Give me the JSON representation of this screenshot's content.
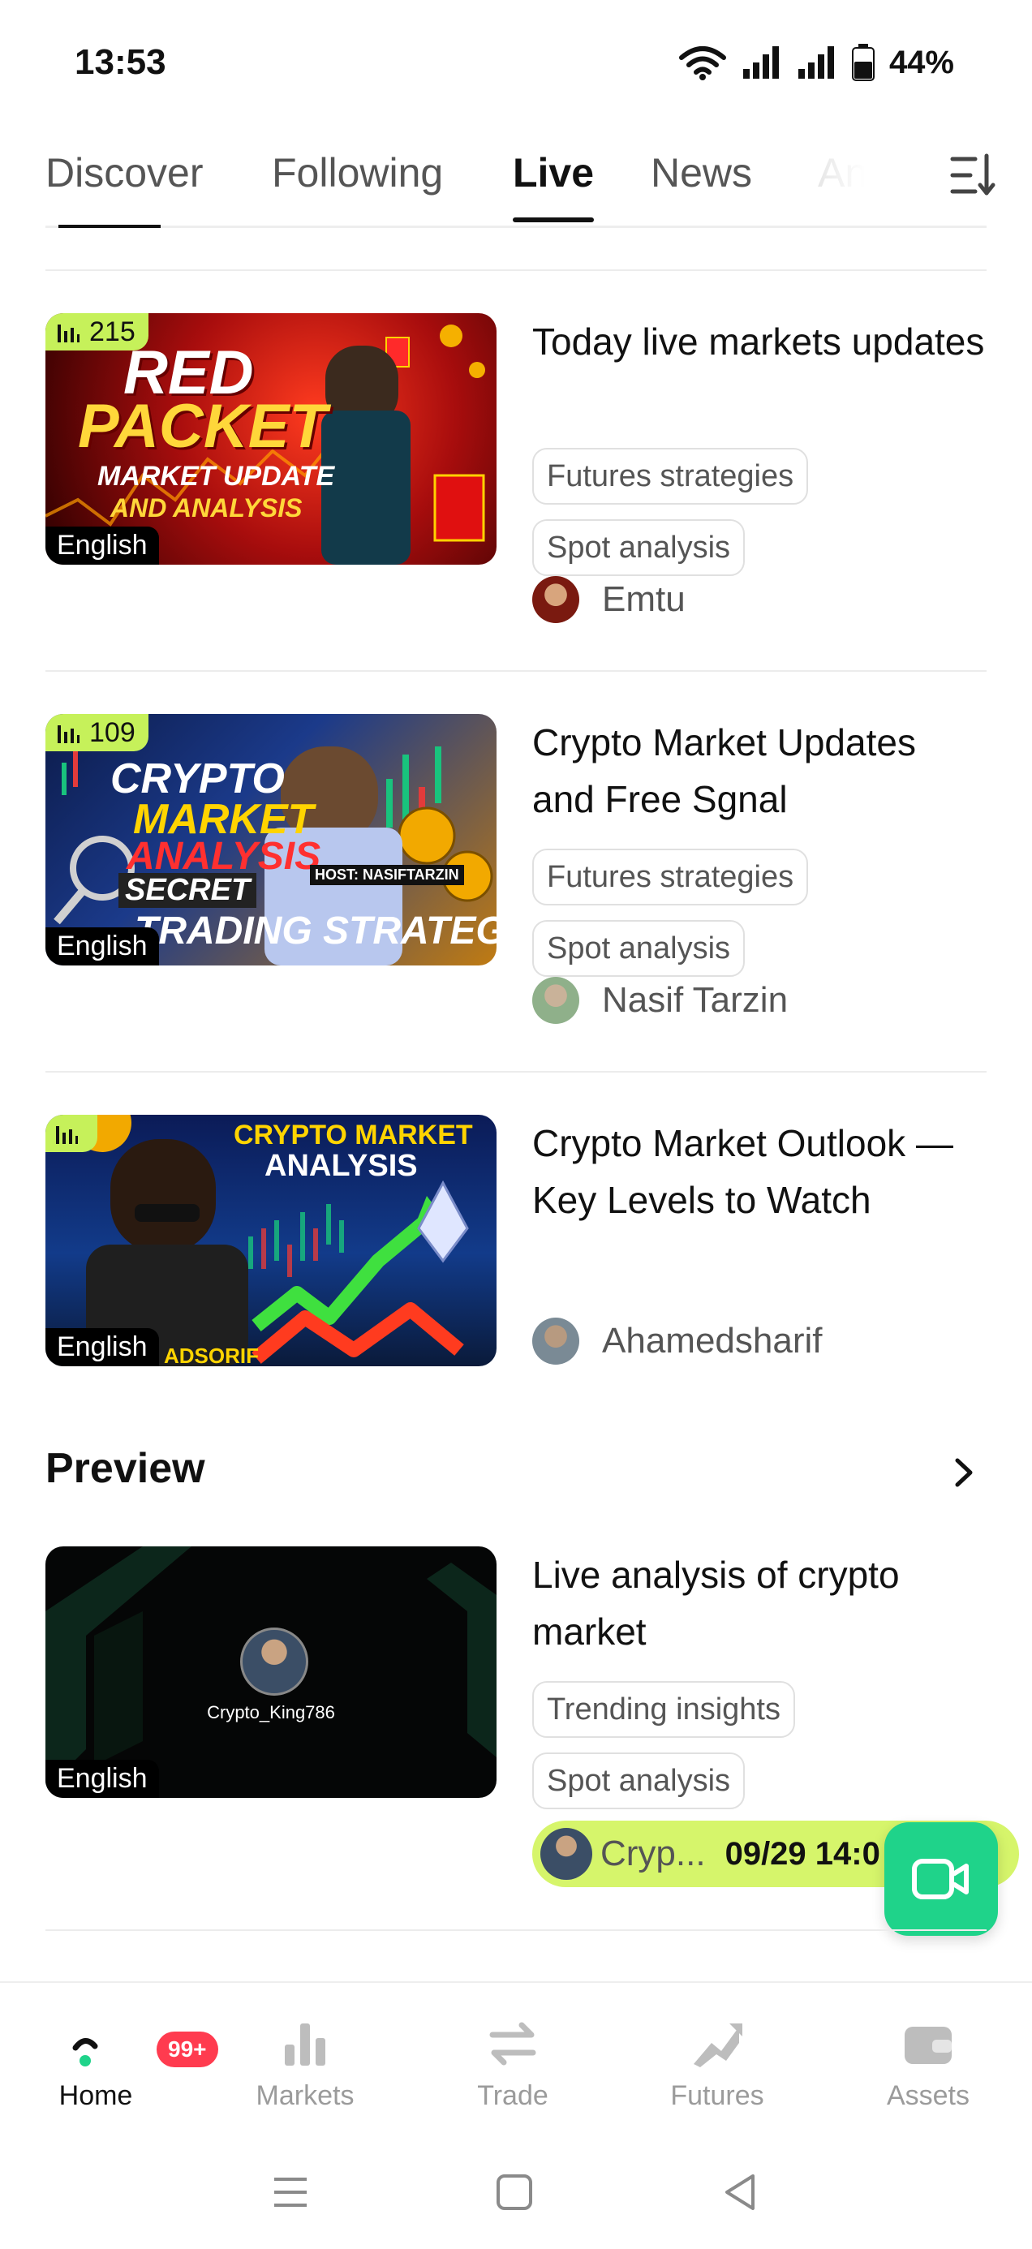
{
  "status": {
    "time": "13:53",
    "battery": "44%"
  },
  "tabs": [
    {
      "label": "Discover"
    },
    {
      "label": "Following"
    },
    {
      "label": "Live"
    },
    {
      "label": "News"
    },
    {
      "label": "An"
    }
  ],
  "live": [
    {
      "viewers": "215",
      "language": "English",
      "thumb_text": [
        "RED",
        "PACKET",
        "MARKET UPDATE",
        "AND ANALYSIS"
      ],
      "title": "Today live markets updates",
      "tags": [
        "Futures strategies",
        "Spot analysis"
      ],
      "author": "Emtu"
    },
    {
      "viewers": "109",
      "language": "English",
      "thumb_text": [
        "CRYPTO",
        "MARKET",
        "ANALYSIS",
        "SECRET",
        "TRADING STRATEGY",
        "HOST: NASIFTARZIN"
      ],
      "title": "Crypto Market Updates and Free Sgnal",
      "tags": [
        "Futures strategies",
        "Spot analysis"
      ],
      "author": "Nasif Tarzin"
    },
    {
      "viewers": "",
      "language": "English",
      "thumb_text": [
        "CRYPTO MARKET",
        "ANALYSIS",
        "ADSORIF"
      ],
      "title": "Crypto Market Outlook — Key Levels to Watch",
      "tags": [],
      "author": "Ahamedsharif"
    }
  ],
  "preview": {
    "section_title": "Preview",
    "item": {
      "language": "English",
      "channel": "Crypto_King786",
      "title": "Live analysis of crypto market",
      "tags": [
        "Trending insights",
        "Spot analysis"
      ],
      "host_short": "Cryp...",
      "schedule": "09/29 14:0"
    }
  },
  "nav": [
    {
      "label": "Home",
      "badge": "99+"
    },
    {
      "label": "Markets"
    },
    {
      "label": "Trade"
    },
    {
      "label": "Futures"
    },
    {
      "label": "Assets"
    }
  ],
  "colors": {
    "accent": "#c6f15a",
    "fab": "#1fd38a",
    "badge": "#ff3b4f"
  }
}
